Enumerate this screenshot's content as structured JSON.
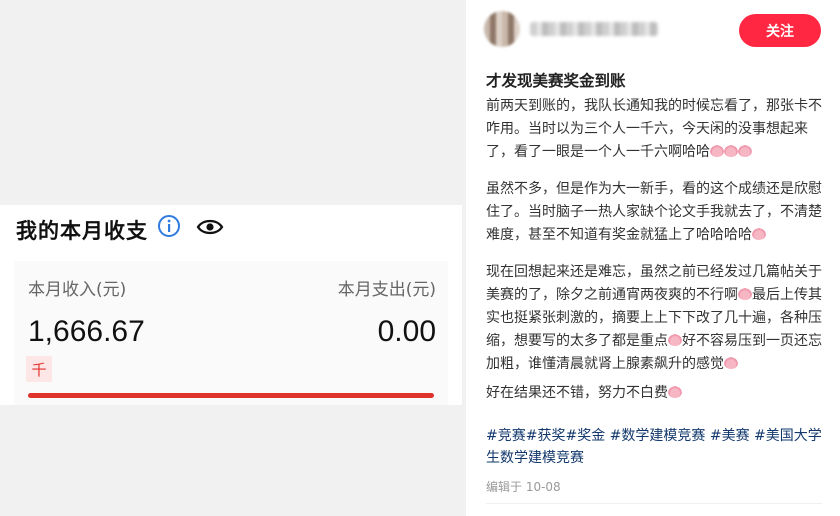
{
  "wallet_card": {
    "title": "我的本月收支",
    "income_label": "本月收入(元)",
    "expense_label": "本月支出(元)",
    "income_value": "1,666.67",
    "expense_value": "0.00",
    "unit_badge": "千",
    "icons": [
      "info-icon",
      "eye-icon"
    ],
    "accent_color": "#e0332c"
  },
  "post": {
    "follow_label": "关注",
    "title": "才发现美赛奖金到账",
    "paragraphs": [
      "前两天到账的，我队长通知我的时候忘看了，那张卡不咋用。当时以为三个人一千六，今天闲的没事想起来了，看了一眼是一个人一千六啊哈哈",
      "虽然不多，但是作为大一新手，看的这个成绩还是欣慰住了。当时脑子一热人家缺个论文手我就去了，不清楚难度，甚至不知道有奖金就猛上了哈哈哈哈",
      "现在回想起来还是难忘，虽然之前已经发过几篇帖关于美赛的了，除夕之前通宵两夜爽的不行啊",
      "好在结果还不错，努力不白费"
    ],
    "paragraph3_part2": "最后上传其实也挺紧张刺激的，摘要上上下下改了几十遍，各种压缩，想要写的太多了都是重点",
    "paragraph3_part3": "好不容易压到一页还忘加粗，谁懂清晨就肾上腺素飙升的感觉",
    "tags": [
      "#竞赛",
      "#获奖",
      "#奖金",
      "#数学建模竞赛",
      "#美赛",
      "#美国大学生数学建模竞赛"
    ],
    "edit_date": "编辑于 10-08",
    "brand_color": "#ff2741",
    "tag_color": "#13386c"
  }
}
